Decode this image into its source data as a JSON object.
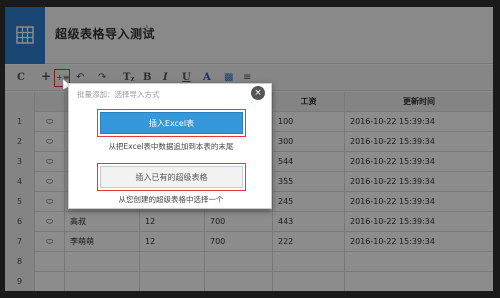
{
  "header": {
    "title": "超级表格导入测试",
    "star": "☆",
    "app_icon": "grid-icon"
  },
  "toolbar": {
    "items": [
      {
        "icon": "refresh-icon",
        "glyph": "C"
      },
      {
        "icon": "plus-icon",
        "glyph": "+"
      },
      {
        "icon": "import-icon",
        "glyph": "+≡"
      },
      {
        "icon": "undo-icon",
        "glyph": "↶"
      },
      {
        "icon": "redo-icon",
        "glyph": "↷"
      },
      {
        "icon": "text-format-icon",
        "glyph": "Tᵪ"
      },
      {
        "icon": "bold-icon",
        "glyph": "B"
      },
      {
        "icon": "italic-icon",
        "glyph": "I"
      },
      {
        "icon": "underline-icon",
        "glyph": "U"
      },
      {
        "icon": "font-color-icon",
        "glyph": "A"
      },
      {
        "icon": "fill-color-icon",
        "glyph": "▩"
      },
      {
        "icon": "align-icon",
        "glyph": "≡"
      }
    ]
  },
  "table": {
    "headers": [
      "",
      "",
      "",
      "",
      "",
      "工资",
      "更新时间"
    ],
    "rows": [
      {
        "n": "1",
        "icon": "comment-icon",
        "a": "",
        "b": "",
        "d": "",
        "e": "100",
        "f": "2016-10-22 15:39:34"
      },
      {
        "n": "2",
        "icon": "comment-icon",
        "a": "",
        "b": "",
        "d": "",
        "e": "300",
        "f": "2016-10-22 15:39:34"
      },
      {
        "n": "3",
        "icon": "comment-icon",
        "a": "",
        "b": "",
        "d": "",
        "e": "544",
        "f": "2016-10-22 15:39:34"
      },
      {
        "n": "4",
        "icon": "comment-icon",
        "a": "",
        "b": "",
        "d": "",
        "e": "355",
        "f": "2016-10-22 15:39:34"
      },
      {
        "n": "5",
        "icon": "comment-icon",
        "a": "",
        "b": "",
        "d": "",
        "e": "245",
        "f": "2016-10-22 15:39:34"
      },
      {
        "n": "6",
        "icon": "comment-icon",
        "a": "高叔",
        "b": "12",
        "d": "700",
        "e": "443",
        "f": "2016-10-22 15:39:34"
      },
      {
        "n": "7",
        "icon": "comment-icon",
        "a": "李萌萌",
        "b": "12",
        "d": "700",
        "e": "222",
        "f": "2016-10-22 15:39:34"
      },
      {
        "n": "8",
        "icon": "",
        "a": "",
        "b": "",
        "d": "",
        "e": "",
        "f": ""
      },
      {
        "n": "9",
        "icon": "",
        "a": "",
        "b": "",
        "d": "",
        "e": "",
        "f": ""
      },
      {
        "n": "10",
        "icon": "",
        "a": "",
        "b": "",
        "d": "",
        "e": "",
        "f": ""
      }
    ]
  },
  "dialog": {
    "title": "批量添加：选择导入方式",
    "close": "×",
    "excel_button": "插入Excel表",
    "excel_desc": "从把Excel表中数据追加到本表的末尾",
    "super_button": "插入已有的超级表格",
    "super_desc": "从您创建的超级表格中选择一个"
  },
  "colors": {
    "accent": "#2f80d1",
    "button_primary": "#3598db",
    "highlight": "#e23b3b"
  }
}
